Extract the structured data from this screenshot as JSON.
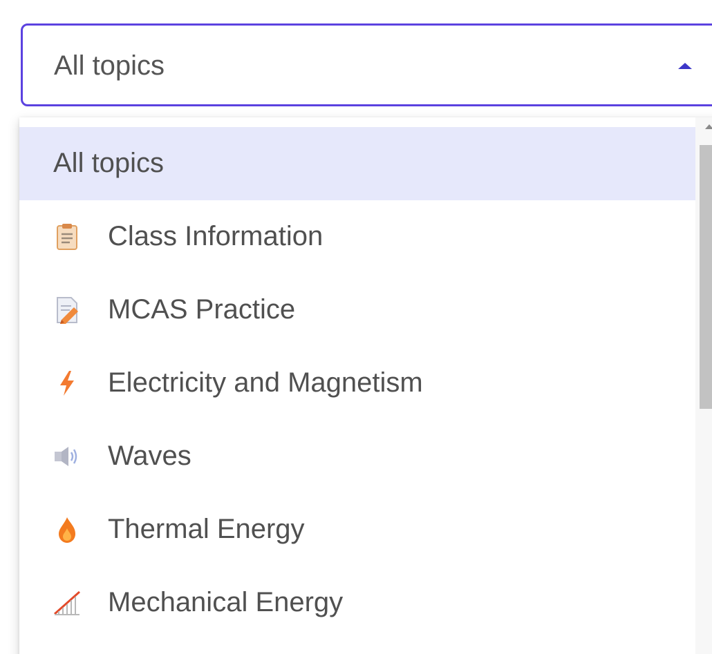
{
  "select": {
    "value": "All topics",
    "icon": "caret-up-icon"
  },
  "options": [
    {
      "label": "All topics",
      "icon": null,
      "selected": true
    },
    {
      "label": "Class Information",
      "icon": "clipboard-icon",
      "selected": false
    },
    {
      "label": "MCAS Practice",
      "icon": "document-pencil-icon",
      "selected": false
    },
    {
      "label": "Electricity and Magnetism",
      "icon": "lightning-icon",
      "selected": false
    },
    {
      "label": "Waves",
      "icon": "speaker-icon",
      "selected": false
    },
    {
      "label": "Thermal Energy",
      "icon": "flame-icon",
      "selected": false
    },
    {
      "label": "Mechanical Energy",
      "icon": "ramp-chart-icon",
      "selected": false
    }
  ],
  "colors": {
    "accent_border": "#5b42e0",
    "selected_bg": "#e6e8fb",
    "text": "#505050"
  }
}
